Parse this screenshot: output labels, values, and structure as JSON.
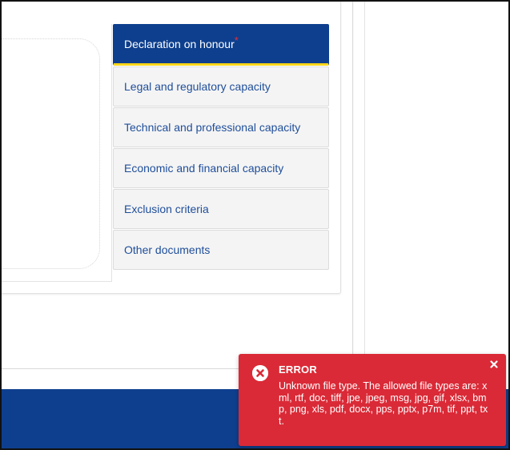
{
  "tabs": [
    {
      "label": "Declaration on honour",
      "required_marker": "*",
      "active": true
    },
    {
      "label": "Legal and regulatory capacity"
    },
    {
      "label": "Technical and professional capacity"
    },
    {
      "label": "Economic and financial capacity"
    },
    {
      "label": "Exclusion criteria"
    },
    {
      "label": "Other documents"
    }
  ],
  "toast": {
    "title": "ERROR",
    "message": "Unknown file type. The allowed file types are: xml, rtf, doc, tiff, jpe, jpeg, msg, jpg, gif, xlsx, bmp, png, xls, pdf, docx, pps, pptx, p7m, tif, ppt, txt.",
    "icon": "error-circle-x-icon",
    "close_icon": "close-icon"
  },
  "colors": {
    "active_tab_bg": "#0e3f8e",
    "active_tab_underline": "#ffd617",
    "tab_text": "#1f4e9a",
    "required_marker": "#e0303a",
    "toast_bg": "#da2a37",
    "footer_bg": "#0e3f8e"
  }
}
